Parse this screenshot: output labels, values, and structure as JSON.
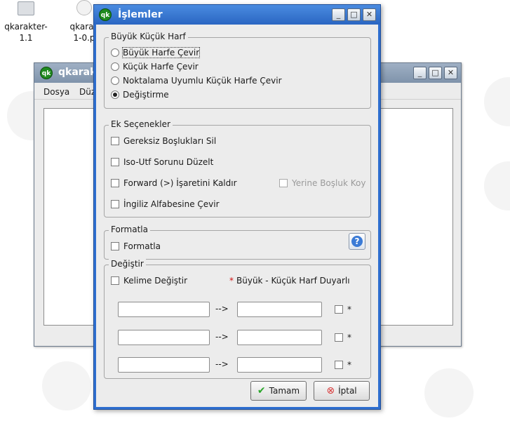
{
  "desktop": {
    "icons": [
      {
        "label_line1": "qkarakter-",
        "label_line2": "1.1"
      },
      {
        "label_line1": "qkarak",
        "label_line2": "1-0.p"
      }
    ]
  },
  "background_window": {
    "title": "qkarak",
    "menu": [
      "Dosya",
      "Düz"
    ]
  },
  "dialog": {
    "title": "İşlemler",
    "case_group": {
      "title": "Büyük Küçük Harf",
      "options": [
        {
          "label": "Büyük Harfe Çevir",
          "selected": false
        },
        {
          "label": "Küçük Harfe Çevir",
          "selected": false
        },
        {
          "label": "Noktalama Uyumlu Küçük Harfe Çevir",
          "selected": false
        },
        {
          "label": "Değiştirme",
          "selected": true
        }
      ]
    },
    "extra_group": {
      "title": "Ek Seçenekler",
      "remove_spaces": "Gereksiz Boşlukları Sil",
      "iso_utf": "Iso-Utf Sorunu Düzelt",
      "forward": "Forward (>) İşaretini Kaldır",
      "space_instead": "Yerine Boşluk Koy",
      "english_alpha": "İngiliz Alfabesine Çevir"
    },
    "format_group": {
      "title": "Formatla",
      "checkbox": "Formatla",
      "help_icon": "?"
    },
    "replace_group": {
      "title": "Değiştir",
      "word_replace": "Kelime Değiştir",
      "case_sensitive_marker": "*",
      "case_sensitive_note": "Büyük - Küçük Harf Duyarlı",
      "arrow": "-->",
      "rows": [
        {
          "from": "",
          "to": "",
          "star": "*"
        },
        {
          "from": "",
          "to": "",
          "star": "*"
        },
        {
          "from": "",
          "to": "",
          "star": "*"
        }
      ]
    },
    "buttons": {
      "ok": "Tamam",
      "cancel": "İptal"
    }
  },
  "window_buttons": {
    "minimize": "_",
    "maximize": "□",
    "close": "✕"
  },
  "colors": {
    "title_active": "#2f6fcf",
    "title_inactive": "#8fa3bb",
    "ok_green": "#2aa52a",
    "cancel_red": "#d83a3a"
  }
}
